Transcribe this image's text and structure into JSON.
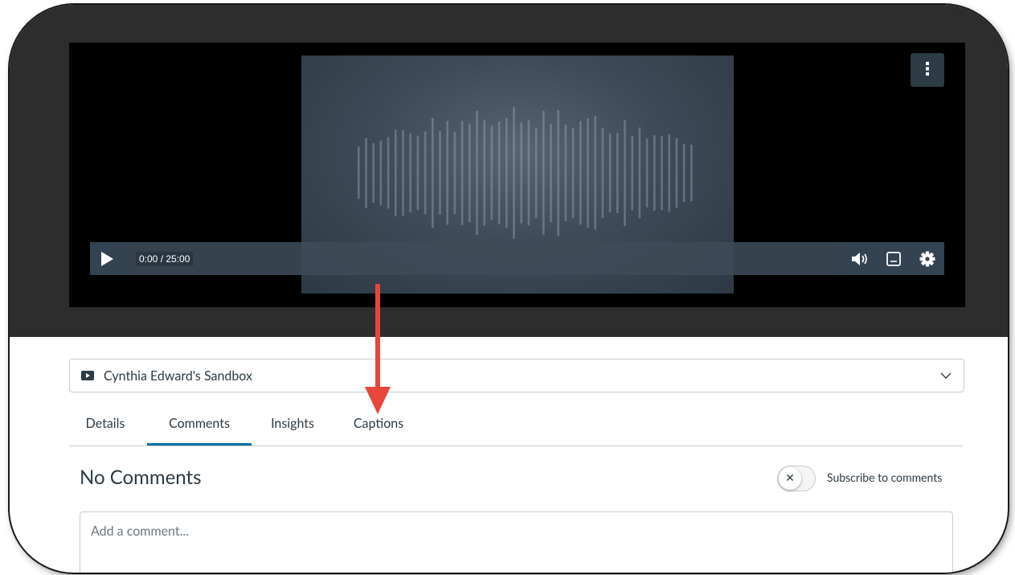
{
  "player": {
    "time_readout": "0:00 / 25:00",
    "menu_icon": "kebab-vertical-icon",
    "controls": {
      "play_icon": "play-icon",
      "volume_icon": "volume-icon",
      "captions_icon": "closed-captions-icon",
      "settings_icon": "gear-icon"
    },
    "poster_icon": "audio-waveform"
  },
  "source_selector": {
    "icon": "video-icon",
    "label": "Cynthia Edward's Sandbox",
    "chevron_icon": "chevron-down-icon"
  },
  "tabs": [
    {
      "label": "Details",
      "active": false
    },
    {
      "label": "Comments",
      "active": true
    },
    {
      "label": "Insights",
      "active": false
    },
    {
      "label": "Captions",
      "active": false
    }
  ],
  "comments": {
    "heading": "No Comments",
    "subscribe_label": "Subscribe to comments",
    "subscribe_enabled": false,
    "input_placeholder": "Add a comment..."
  },
  "colors": {
    "accent": "#0770a3",
    "annotation_arrow": "#e8453c",
    "text": "#2d3b45"
  }
}
